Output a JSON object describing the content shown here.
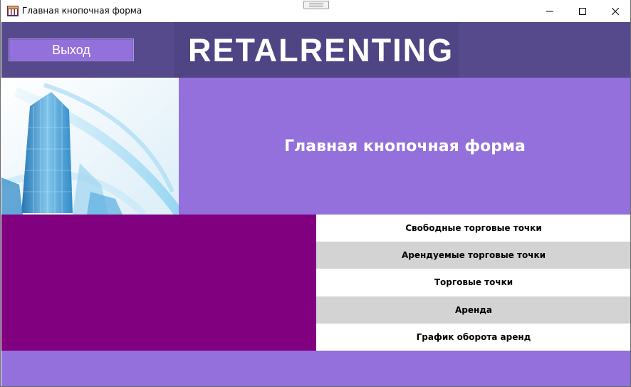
{
  "window": {
    "title": "Главная кнопочная форма",
    "controls": [
      "minimize-icon",
      "maximize-icon",
      "close-icon"
    ]
  },
  "header": {
    "exit_label": "Выход",
    "logo_text": "RETALRENTING"
  },
  "banner": {
    "title": "Главная кнопочная форма",
    "image": "skyscraper-illustration"
  },
  "menu": {
    "items": [
      {
        "label": "Свободные торговые точки"
      },
      {
        "label": "Арендуемые торговые точки"
      },
      {
        "label": "Торговые точки"
      },
      {
        "label": "Аренда"
      },
      {
        "label": "График оборота аренд"
      }
    ]
  },
  "colors": {
    "header_bg": "#564a8c",
    "accent_purple": "#9370db",
    "panel_magenta": "#800080",
    "menu_alt": "#d3d3d3"
  }
}
